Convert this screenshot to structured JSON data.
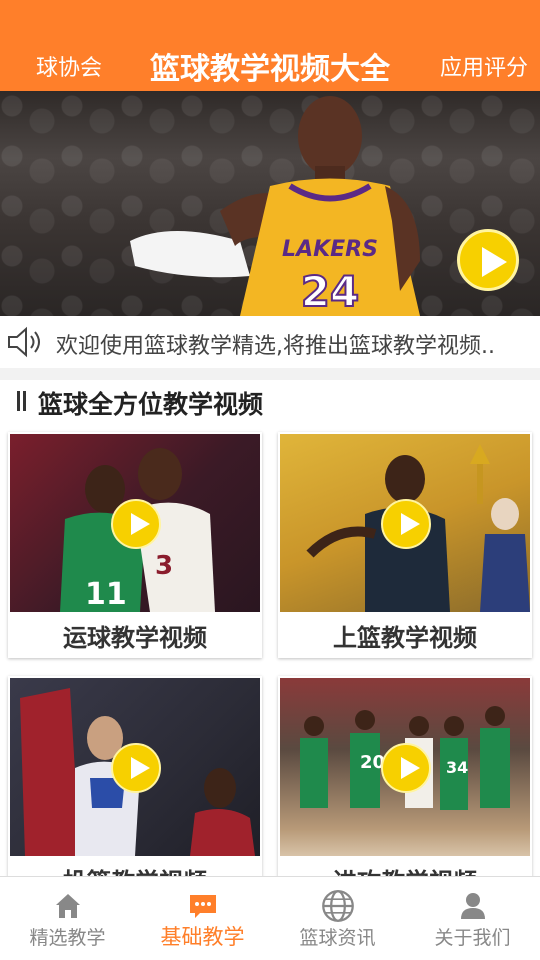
{
  "header": {
    "left_label": "球协会",
    "title": "篮球教学视频大全",
    "right_label": "应用评分",
    "color": "#ff7f2a"
  },
  "banner": {
    "jersey_text": "LAKERS",
    "jersey_number": "24",
    "play_icon": "play-icon"
  },
  "notice": {
    "icon": "speaker-icon",
    "text": "欢迎使用篮球教学精选,将推出篮球教学视频.."
  },
  "section": {
    "title": "篮球全方位教学视频"
  },
  "cards": [
    {
      "caption": "运球教学视频"
    },
    {
      "caption": "上篮教学视频"
    },
    {
      "caption": "投篮教学视频"
    },
    {
      "caption": "进攻教学视频"
    }
  ],
  "bottom_nav": {
    "items": [
      {
        "label": "精选教学",
        "icon": "home-icon"
      },
      {
        "label": "基础教学",
        "icon": "message-icon",
        "active": true
      },
      {
        "label": "篮球资讯",
        "icon": "globe-icon"
      },
      {
        "label": "关于我们",
        "icon": "user-icon"
      }
    ],
    "active_color": "#ff7f2a"
  }
}
